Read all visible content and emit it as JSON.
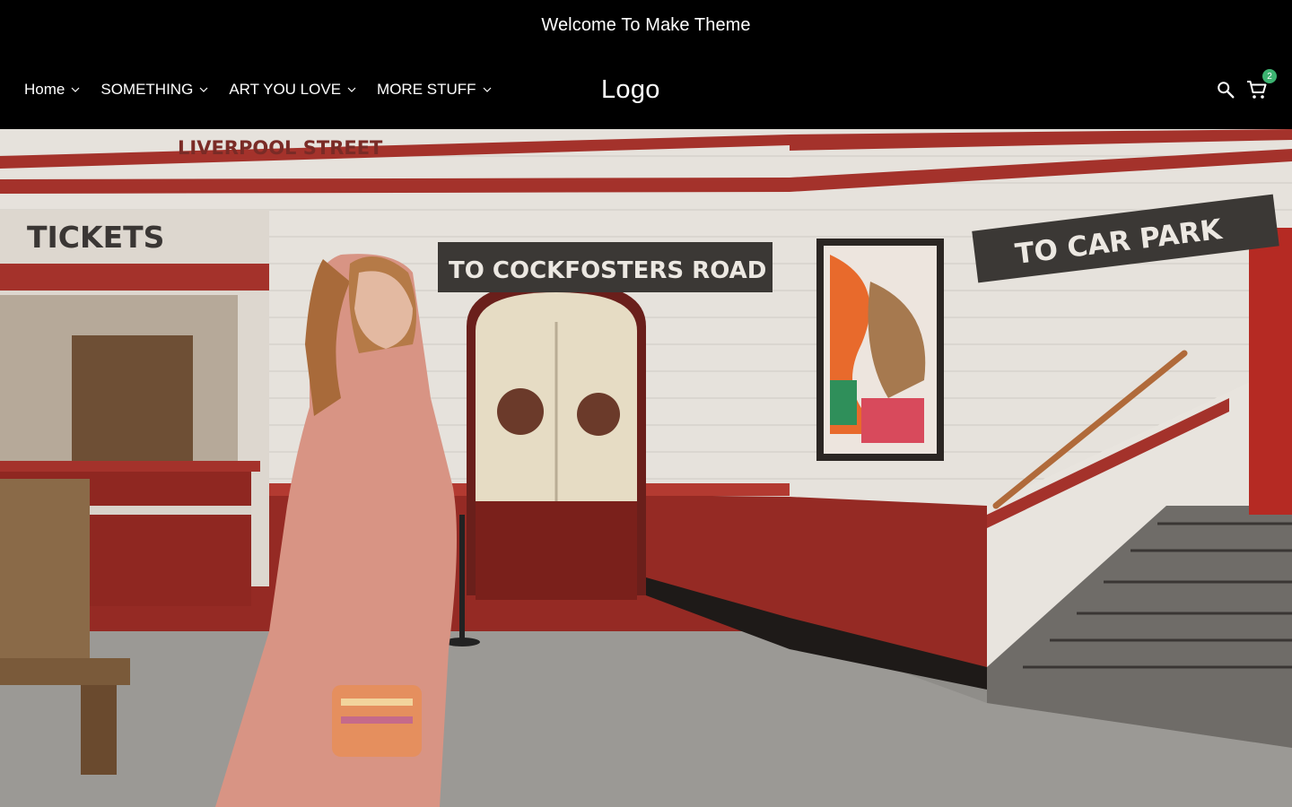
{
  "announcement": {
    "text": "Welcome To Make Theme"
  },
  "nav": {
    "items": [
      {
        "label": "Home"
      },
      {
        "label": "SOMETHING"
      },
      {
        "label": "ART YOU LOVE"
      },
      {
        "label": "MORE STUFF"
      }
    ]
  },
  "logo": {
    "text": "Logo"
  },
  "actions": {
    "cart_count": "2"
  },
  "hero": {
    "signs": {
      "station": "LIVERPOOL STREET",
      "tickets": "TICKETS",
      "cockfosters": "TO COCKFOSTERS ROAD",
      "car_park": "TO CAR PARK"
    }
  },
  "colors": {
    "background": "#000000",
    "text": "#ffffff",
    "badge": "#3cb371",
    "tile_red": "#9e2b25",
    "tile_white": "#ece8e2"
  }
}
